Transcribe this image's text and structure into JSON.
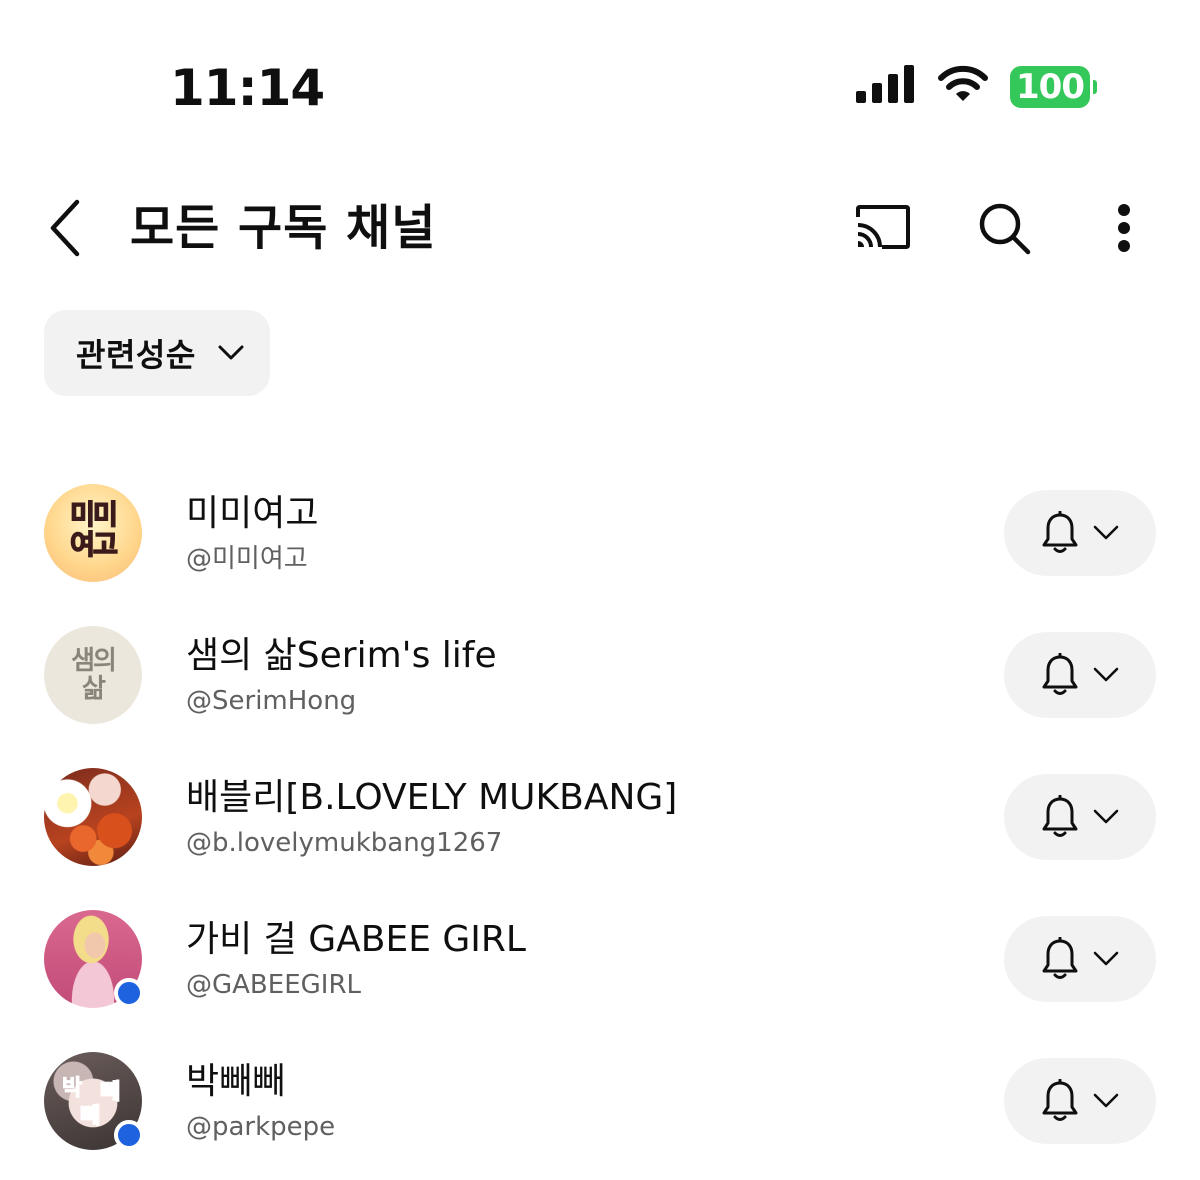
{
  "status_bar": {
    "time": "11:14",
    "battery": "100",
    "icons": [
      "cellular-signal-icon",
      "wifi-icon",
      "battery-icon"
    ]
  },
  "header": {
    "title": "모든 구독 채널",
    "icons": [
      "back-chevron-icon",
      "cast-icon",
      "search-icon",
      "more-vertical-icon"
    ]
  },
  "sort": {
    "label": "관련성순",
    "icon": "chevron-down-icon"
  },
  "channels": [
    {
      "name": "미미여고",
      "handle": "@미미여고",
      "avatar_text": [
        "미미",
        "여고"
      ],
      "new_content_dot": false
    },
    {
      "name": "샘의 삶Serim's life",
      "handle": "@SerimHong",
      "avatar_text": [
        "샘의",
        "삶"
      ],
      "new_content_dot": false
    },
    {
      "name": "배블리[B.LOVELY MUKBANG]",
      "handle": "@b.lovelymukbang1267",
      "new_content_dot": false
    },
    {
      "name": "가비 걸 GABEE GIRL",
      "handle": "@GABEEGIRL",
      "new_content_dot": true
    },
    {
      "name": "박빼빼",
      "handle": "@parkpepe",
      "avatar_text": [
        "박",
        "빼",
        "빼"
      ],
      "new_content_dot": true
    }
  ],
  "colors": {
    "battery": "#34c759",
    "chip_background": "#f2f2f2",
    "handle_text": "#606060",
    "new_content_dot": "#1e62e0"
  }
}
